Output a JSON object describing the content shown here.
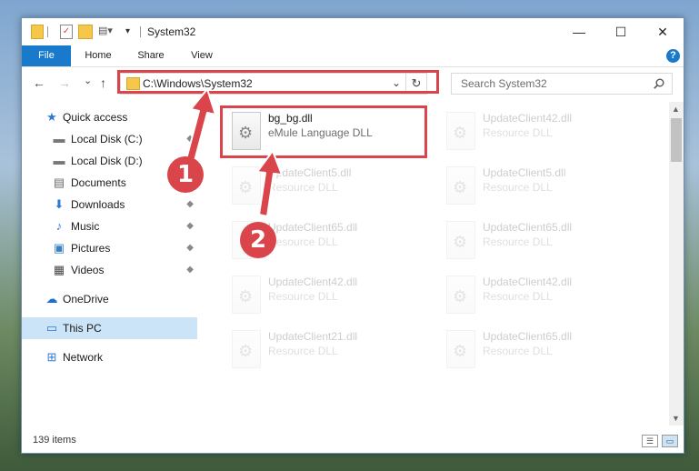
{
  "window": {
    "title": "System32",
    "minimize_glyph": "—",
    "maximize_glyph": "☐",
    "close_glyph": "✕"
  },
  "ribbon": {
    "tabs": [
      "File",
      "Home",
      "Share",
      "View"
    ],
    "help_glyph": "?",
    "accent_color": "#1979ca"
  },
  "navbar": {
    "back_glyph": "←",
    "forward_glyph": "→",
    "recent_glyph": "⌄",
    "up_glyph": "↑",
    "address": "C:\\Windows\\System32",
    "address_dropdown_glyph": "⌄",
    "refresh_glyph": "↻",
    "search_placeholder": "Search System32",
    "search_icon": "search-icon"
  },
  "sidebar": {
    "items": [
      {
        "label": "Quick access",
        "icon": "star-icon",
        "glyph": "★"
      },
      {
        "label": "Local Disk (C:)",
        "icon": "drive-icon",
        "glyph": "▬"
      },
      {
        "label": "Local Disk (D:)",
        "icon": "drive-icon",
        "glyph": "▬"
      },
      {
        "label": "Documents",
        "icon": "document-icon",
        "glyph": "▤"
      },
      {
        "label": "Downloads",
        "icon": "download-icon",
        "glyph": "⬇"
      },
      {
        "label": "Music",
        "icon": "music-icon",
        "glyph": "♪"
      },
      {
        "label": "Pictures",
        "icon": "picture-icon",
        "glyph": "▣"
      },
      {
        "label": "Videos",
        "icon": "video-icon",
        "glyph": "▦"
      },
      {
        "label": "OneDrive",
        "icon": "cloud-icon",
        "glyph": "☁"
      },
      {
        "label": "This PC",
        "icon": "computer-icon",
        "glyph": "▭"
      },
      {
        "label": "Network",
        "icon": "network-icon",
        "glyph": "⊞"
      }
    ],
    "pin_glyph": "📌"
  },
  "files": [
    {
      "name": "bg_bg.dll",
      "type": "eMule Language DLL"
    },
    {
      "name": "UpdateClient42.dll",
      "type": "Resource DLL"
    },
    {
      "name": "UpdateClient5.dll",
      "type": "Resource DLL"
    },
    {
      "name": "UpdateClient5.dll",
      "type": "Resource DLL"
    },
    {
      "name": "UpdateClient65.dll",
      "type": "Resource DLL"
    },
    {
      "name": "UpdateClient65.dll",
      "type": "Resource DLL"
    },
    {
      "name": "UpdateClient42.dll",
      "type": "Resource DLL"
    },
    {
      "name": "UpdateClient42.dll",
      "type": "Resource DLL"
    },
    {
      "name": "UpdateClient21.dll",
      "type": "Resource DLL"
    },
    {
      "name": "UpdateClient65.dll",
      "type": "Resource DLL"
    }
  ],
  "status": {
    "item_count": "139 items"
  },
  "annotations": {
    "step1": "1",
    "step2": "2",
    "color": "#d9454a"
  }
}
